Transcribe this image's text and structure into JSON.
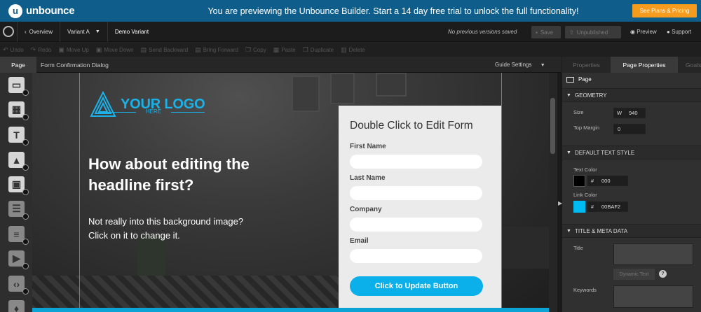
{
  "banner": {
    "brand": "unbounce",
    "brand_mark": "u",
    "message": "You are previewing the Unbounce Builder. Start a 14 day free trial to unlock the full functionality!",
    "cta": "See Plans & Pricing",
    "bg_color": "#0f5d8a",
    "cta_color": "#f59b1d"
  },
  "nav": {
    "overview": "Overview",
    "variant": "Variant A",
    "variant_name": "Demo Variant",
    "versions_msg": "No previous versions saved",
    "save": "Save",
    "unpublished": "Unpublished",
    "preview": "Preview",
    "support": "Support"
  },
  "toolbar": {
    "undo": "Undo",
    "redo": "Redo",
    "move_up": "Move Up",
    "move_down": "Move Down",
    "send_backward": "Send Backward",
    "bring_forward": "Bring Forward",
    "copy": "Copy",
    "paste": "Paste",
    "duplicate": "Duplicate",
    "delete": "Delete"
  },
  "pagebar": {
    "tab": "Page",
    "dialog": "Form Confirmation Dialog",
    "guide_settings": "Guide Settings"
  },
  "widgets": [
    "box-icon",
    "section-icon",
    "text-icon",
    "image-icon",
    "button-icon",
    "form-icon",
    "list-icon",
    "video-icon",
    "code-icon",
    "social-icon"
  ],
  "canvas": {
    "logo_text": "YOUR LOGO",
    "logo_sub": "HERE",
    "headline": "How about editing the headline first?",
    "subtext": "Not really into this background image? Click on it to change it.",
    "accent": "#0bb0ea"
  },
  "form": {
    "title": "Double Click to Edit Form",
    "fields": [
      "First Name",
      "Last Name",
      "Company",
      "Email"
    ],
    "button": "Click to Update Button"
  },
  "panel": {
    "tabs": [
      "Properties",
      "Page Properties",
      "Goals"
    ],
    "title": "Page",
    "geometry_label": "GEOMETRY",
    "size_label": "Size",
    "w_label": "W",
    "width_value": "940",
    "top_margin_label": "Top Margin",
    "top_margin_value": "0",
    "text_style_label": "DEFAULT TEXT STYLE",
    "text_color_label": "Text Color",
    "text_color_value": "000",
    "text_color": "#000000",
    "link_color_label": "Link Color",
    "link_color_value": "00BAF2",
    "link_color": "#00baf2",
    "hash": "#",
    "meta_label": "TITLE & META DATA",
    "title_label": "Title",
    "dynamic_text": "Dynamic Text",
    "help": "?",
    "keywords_label": "Keywords"
  }
}
